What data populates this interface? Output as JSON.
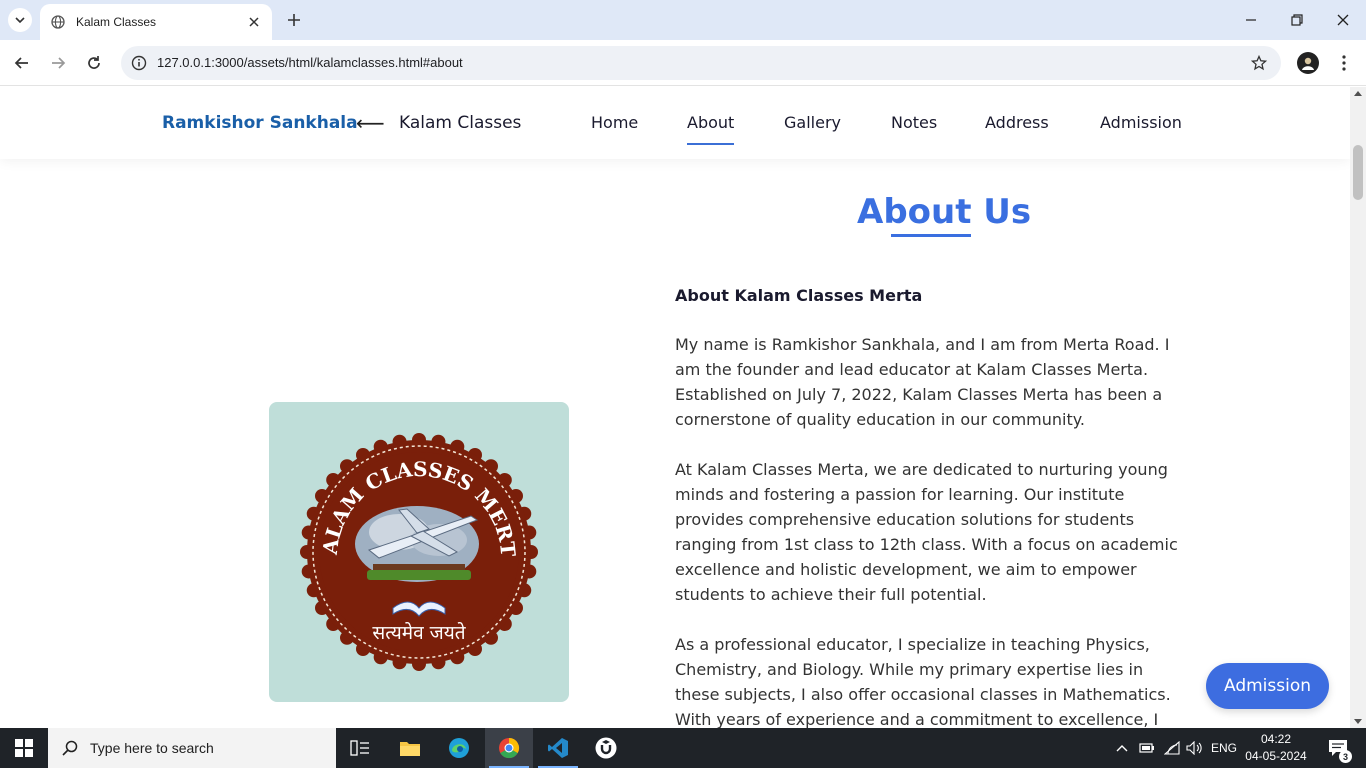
{
  "browser": {
    "tab_title": "Kalam Classes",
    "url": "127.0.0.1:3000/assets/html/kalamclasses.html#about"
  },
  "header": {
    "brand": "Ramkishor Sankhala",
    "arrow": "⟵",
    "site_name": "Kalam Classes",
    "nav": [
      "Home",
      "About",
      "Gallery",
      "Notes",
      "Address",
      "Admission"
    ],
    "active_nav": "About"
  },
  "about": {
    "title": "About Us",
    "heading": "About Kalam Classes Merta",
    "paragraphs": [
      "My name is Ramkishor Sankhala, and I am from Merta Road. I am the founder and lead educator at Kalam Classes Merta. Established on July 7, 2022, Kalam Classes Merta has been a cornerstone of quality education in our community.",
      "At Kalam Classes Merta, we are dedicated to nurturing young minds and fostering a passion for learning. Our institute provides comprehensive education solutions for students ranging from 1st class to 12th class. With a focus on academic excellence and holistic development, we aim to empower students to achieve their full potential.",
      "As a professional educator, I specialize in teaching Physics, Chemistry, and Biology. While my primary expertise lies in these subjects, I also offer occasional classes in Mathematics. With years of experience and a commitment to excellence, I strive to"
    ],
    "logo": {
      "top_text": "KALAM CLASSES MERTA",
      "bottom_text": "सत्यमेव जयते"
    }
  },
  "floating_button": "Admission",
  "taskbar": {
    "search_placeholder": "Type here to search",
    "language": "ENG",
    "time": "04:22",
    "date": "04-05-2024",
    "notifications": "3"
  },
  "colors": {
    "accent": "#3a6fe0",
    "brand": "#1a5fa8",
    "logo_bg": "#bfded9",
    "seal": "#7a1f0a"
  }
}
